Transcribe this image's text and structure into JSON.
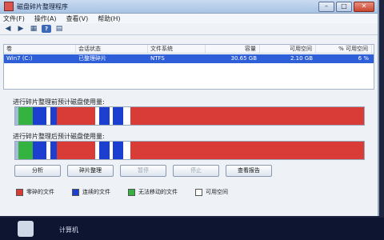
{
  "window": {
    "title": "磁盘碎片整理程序"
  },
  "titlebar": {
    "min": "–",
    "max": "□",
    "close": "✕"
  },
  "menu": [
    "文件(F)",
    "操作(A)",
    "查看(V)",
    "帮助(H)"
  ],
  "toolbar": {
    "back": "◀",
    "forward": "▶",
    "view": "▦",
    "help": "?",
    "properties": "▤"
  },
  "list": {
    "headers": [
      "卷",
      "会话状态",
      "文件系统",
      "容量",
      "可用空间",
      "% 可用空间"
    ],
    "row": [
      "Win7 (C:)",
      "已整理碎片",
      "NTFS",
      "30.65 GB",
      "2.10 GB",
      "6 %"
    ]
  },
  "before": {
    "label": "进行碎片整理前预计磁盘使用量:"
  },
  "after": {
    "label": "进行碎片整理后预计磁盘使用量:"
  },
  "buttons": [
    "分析",
    "碎片整理",
    "暂停",
    "停止",
    "查看报告"
  ],
  "legend": [
    "零碎的文件",
    "连续的文件",
    "无法移动的文件",
    "可用空间"
  ],
  "colors": {
    "fragmented": "#d93b36",
    "contiguous": "#1d3fcf",
    "unmovable": "#35b341",
    "free": "#ffffff"
  },
  "taskbar": {
    "label": "计算机"
  }
}
